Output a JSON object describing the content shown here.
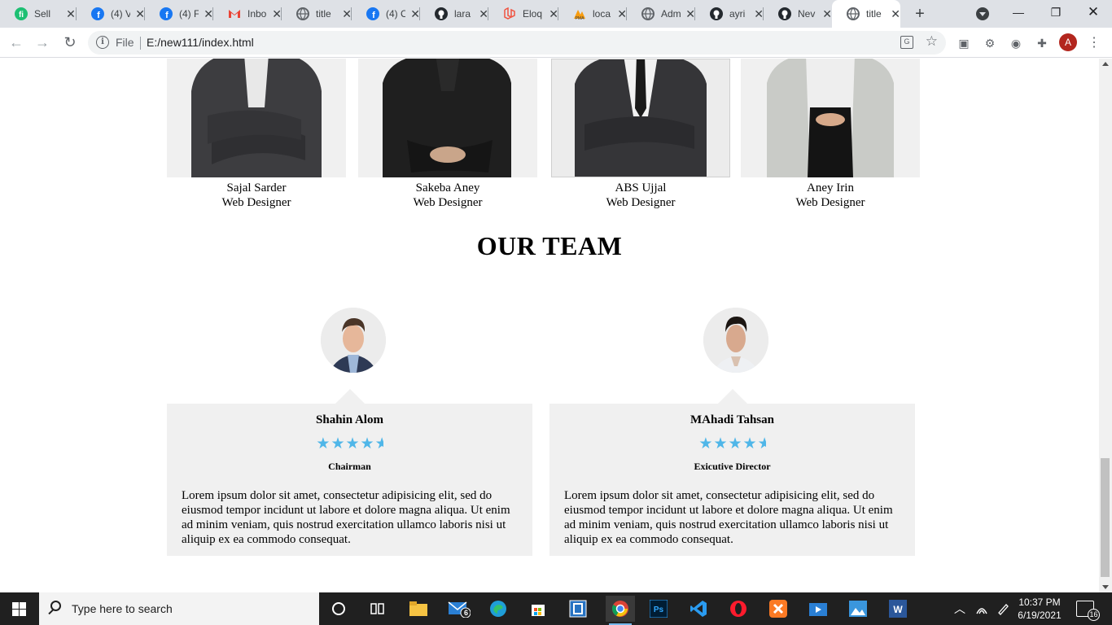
{
  "browser": {
    "tabs": [
      {
        "title": "Sell",
        "icon": "fiverr-icon",
        "color": "#1dbf73"
      },
      {
        "title": "(4) V",
        "icon": "facebook-icon",
        "color": "#1877f2"
      },
      {
        "title": "(4) F",
        "icon": "facebook-icon",
        "color": "#1877f2"
      },
      {
        "title": "Inbo",
        "icon": "gmail-icon",
        "color": "#ea4335"
      },
      {
        "title": "title",
        "icon": "globe-icon",
        "color": "#5f6368"
      },
      {
        "title": "(4) C",
        "icon": "facebook-icon",
        "color": "#1877f2"
      },
      {
        "title": "lara",
        "icon": "github-icon",
        "color": "#24292e"
      },
      {
        "title": "Eloq",
        "icon": "laravel-icon",
        "color": "#f05340"
      },
      {
        "title": "loca",
        "icon": "phpmyadmin-icon",
        "color": "#f89c0e"
      },
      {
        "title": "Adm",
        "icon": "globe-icon",
        "color": "#5f6368"
      },
      {
        "title": "ayri",
        "icon": "github-icon",
        "color": "#24292e"
      },
      {
        "title": "Nev",
        "icon": "github-icon",
        "color": "#24292e"
      },
      {
        "title": "title",
        "icon": "globe-icon",
        "color": "#5f6368",
        "active": true
      }
    ],
    "address": {
      "scheme_label": "File",
      "url": "E:/new111/index.html"
    },
    "profile_initial": "A"
  },
  "page": {
    "staff": [
      {
        "name": "Sajal Sarder",
        "role": "Web Designer"
      },
      {
        "name": "Sakeba Aney",
        "role": "Web Designer"
      },
      {
        "name": "ABS Ujjal",
        "role": "Web Designer"
      },
      {
        "name": "Aney Irin",
        "role": "Web Designer"
      }
    ],
    "team_title": "OUR TEAM",
    "members": [
      {
        "name": "Shahin Alom",
        "rating": 4.5,
        "role": "Chairman",
        "text": "Lorem ipsum dolor sit amet, consectetur adipisicing elit, sed do eiusmod tempor incidunt ut labore et dolore magna aliqua. Ut enim ad minim veniam, quis nostrud exercitation ullamco laboris nisi ut aliquip ex ea commodo consequat."
      },
      {
        "name": "MAhadi Tahsan",
        "rating": 4.5,
        "role": "Exicutive Director",
        "text": "Lorem ipsum dolor sit amet, consectetur adipisicing elit, sed do eiusmod tempor incidunt ut labore et dolore magna aliqua. Ut enim ad minim veniam, quis nostrud exercitation ullamco laboris nisi ut aliquip ex ea commodo consequat."
      }
    ],
    "star_color": "#4fb6e8"
  },
  "taskbar": {
    "search_placeholder": "Type here to search",
    "mail_badge": "6",
    "time": "10:37 PM",
    "date": "6/19/2021",
    "notification_count": "16",
    "apps": [
      "cortana-icon",
      "task-view-icon",
      "file-explorer-icon",
      "mail-icon",
      "edge-icon",
      "store-icon",
      "app-icon",
      "chrome-icon",
      "photoshop-icon",
      "vscode-icon",
      "opera-icon",
      "xampp-icon",
      "video-editor-icon",
      "photos-icon",
      "word-icon"
    ]
  }
}
